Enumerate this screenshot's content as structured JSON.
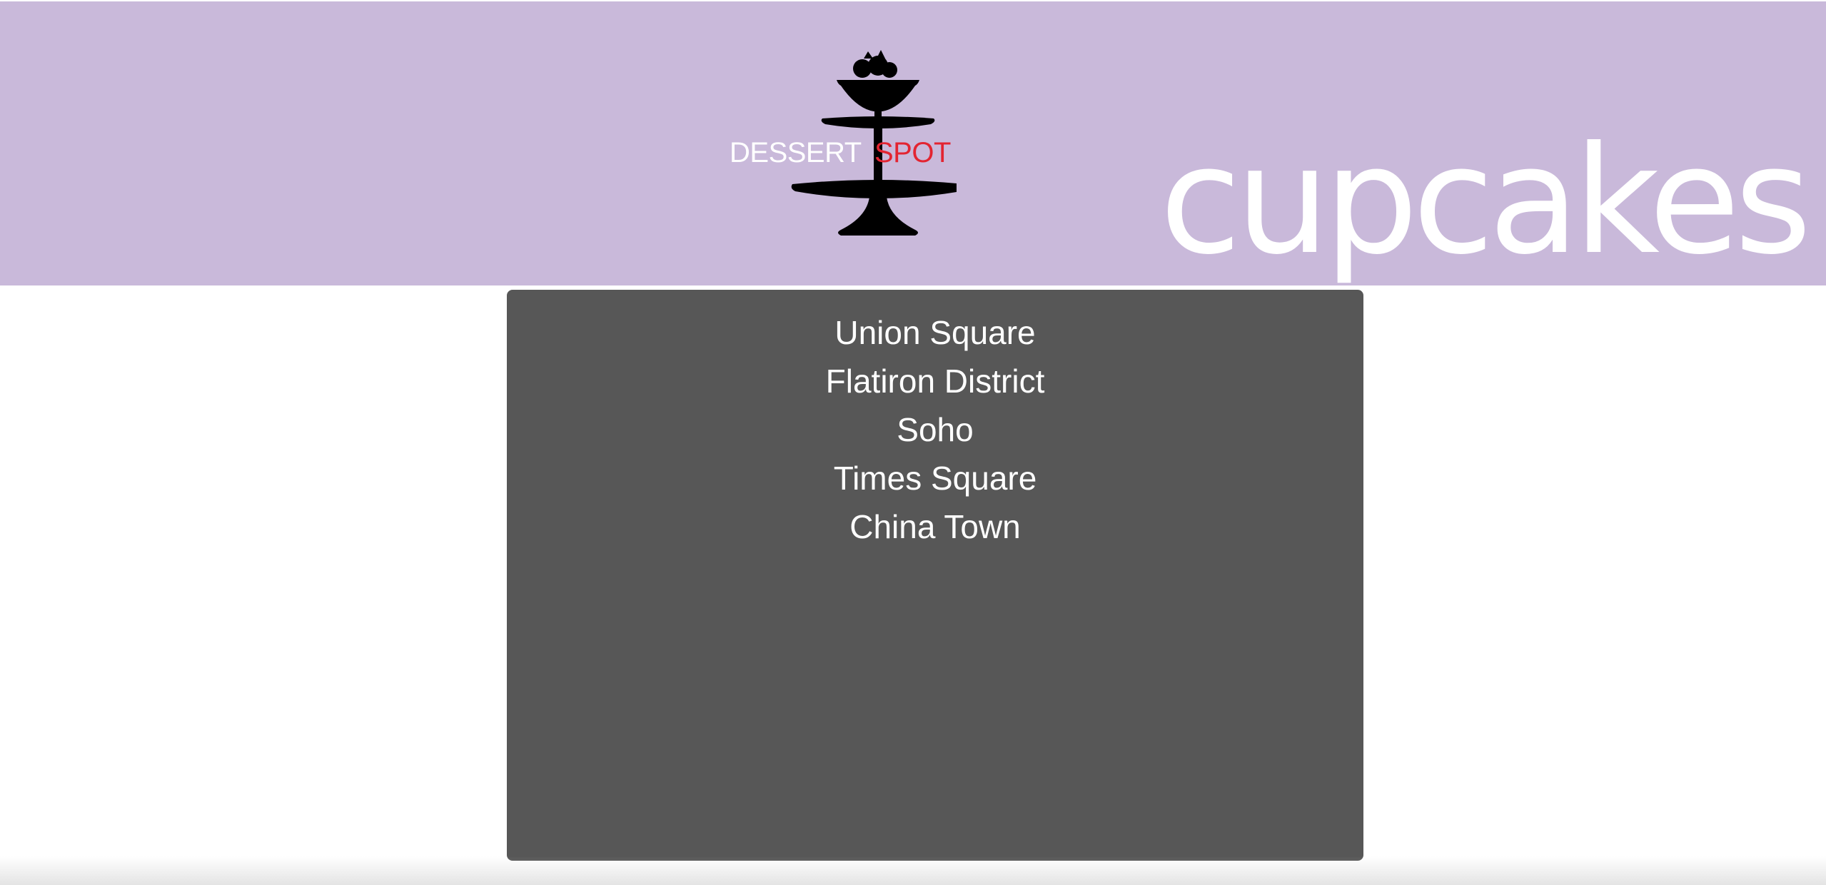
{
  "colors": {
    "header_background": "#c9b9da",
    "panel_background": "#575757",
    "brand_red": "#e32431"
  },
  "header": {
    "logo": {
      "icon": "dessert-stand-icon",
      "word_left": "DESSERT",
      "word_right": "SPOT"
    },
    "headline": "cupcakes"
  },
  "locations": [
    {
      "label": "Union Square"
    },
    {
      "label": "Flatiron District"
    },
    {
      "label": "Soho"
    },
    {
      "label": "Times Square"
    },
    {
      "label": "China Town"
    }
  ]
}
